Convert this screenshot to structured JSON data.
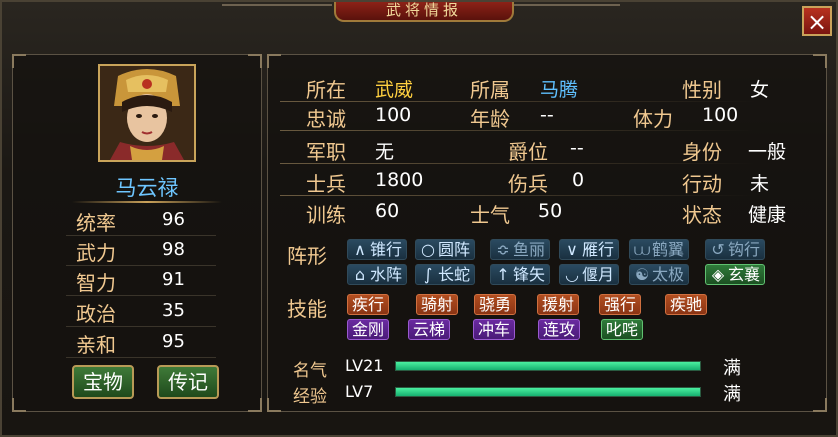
{
  "window": {
    "title": "武将情报",
    "close_label": "×"
  },
  "general": {
    "name": "马云禄",
    "stats": [
      {
        "label": "统率",
        "value": "96"
      },
      {
        "label": "武力",
        "value": "98"
      },
      {
        "label": "智力",
        "value": "91"
      },
      {
        "label": "政治",
        "value": "35"
      },
      {
        "label": "亲和",
        "value": "95"
      }
    ],
    "buttons": {
      "treasure": "宝物",
      "biography": "传记"
    }
  },
  "info": {
    "location_label": "所在",
    "location_value": "武威",
    "faction_label": "所属",
    "faction_value": "马腾",
    "gender_label": "性别",
    "gender_value": "女",
    "loyalty_label": "忠诚",
    "loyalty_value": "100",
    "age_label": "年龄",
    "age_value": "--",
    "stamina_label": "体力",
    "stamina_value": "100",
    "post_label": "军职",
    "post_value": "无",
    "rank_label": "爵位",
    "rank_value": "--",
    "status_label": "身份",
    "status_value": "一般",
    "soldiers_label": "士兵",
    "soldiers_value": "1800",
    "wounded_label": "伤兵",
    "wounded_value": "0",
    "action_label": "行动",
    "action_value": "未",
    "training_label": "训练",
    "training_value": "60",
    "morale_label": "士气",
    "morale_value": "50",
    "condition_label": "状态",
    "condition_value": "健康"
  },
  "formations": {
    "label": "阵形",
    "items": [
      {
        "icon": "∧",
        "name": "锥行",
        "state": "normal"
      },
      {
        "icon": "○",
        "name": "圆阵",
        "state": "normal"
      },
      {
        "icon": "≎",
        "name": "鱼丽",
        "state": "dim"
      },
      {
        "icon": "∨",
        "name": "雁行",
        "state": "normal"
      },
      {
        "icon": "⩊",
        "name": "鹤翼",
        "state": "dim"
      },
      {
        "icon": "↺",
        "name": "钩行",
        "state": "dim"
      },
      {
        "icon": "⌂",
        "name": "水阵",
        "state": "normal"
      },
      {
        "icon": "∫",
        "name": "长蛇",
        "state": "normal"
      },
      {
        "icon": "↑",
        "name": "锋矢",
        "state": "normal"
      },
      {
        "icon": "◡",
        "name": "偃月",
        "state": "normal"
      },
      {
        "icon": "☯",
        "name": "太极",
        "state": "dim"
      },
      {
        "icon": "◈",
        "name": "玄襄",
        "state": "active"
      }
    ]
  },
  "skills": {
    "label": "技能",
    "items": [
      {
        "name": "疾行",
        "color": "orange"
      },
      {
        "name": "骑射",
        "color": "orange"
      },
      {
        "name": "骁勇",
        "color": "orange"
      },
      {
        "name": "援射",
        "color": "orange"
      },
      {
        "name": "强行",
        "color": "orange"
      },
      {
        "name": "疾驰",
        "color": "orange"
      },
      {
        "name": "金刚",
        "color": "purple"
      },
      {
        "name": "云梯",
        "color": "purple"
      },
      {
        "name": "冲车",
        "color": "purple"
      },
      {
        "name": "连攻",
        "color": "purple"
      },
      {
        "name": "叱咤",
        "color": "green"
      }
    ]
  },
  "progress": {
    "fame": {
      "label": "名气",
      "level": "LV21",
      "fraction": 1.0,
      "status": "满"
    },
    "exp": {
      "label": "经验",
      "level": "LV7",
      "fraction": 1.0,
      "status": "满"
    }
  }
}
